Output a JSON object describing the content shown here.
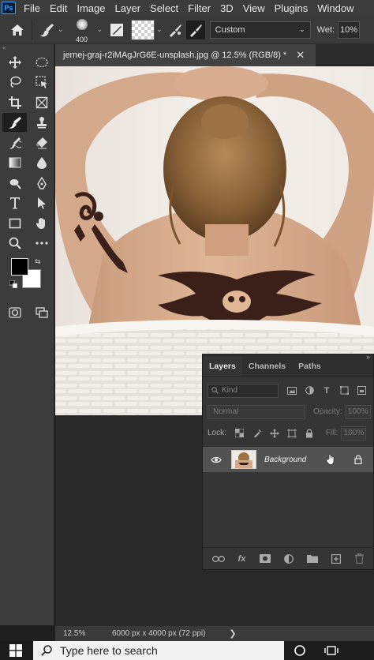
{
  "app": {
    "logo_text": "Ps"
  },
  "menu": [
    "File",
    "Edit",
    "Image",
    "Layer",
    "Select",
    "Filter",
    "3D",
    "View",
    "Plugins",
    "Window"
  ],
  "options_bar": {
    "brush_size": "400",
    "preset_value": "Custom",
    "wet_label": "Wet:",
    "wet_value": "10%"
  },
  "document": {
    "tab_title": "jernej-graj-r2iMAgJrG6E-unsplash.jpg @ 12.5% (RGB/8) *",
    "close_glyph": "✕"
  },
  "colors": {
    "foreground": "#000000",
    "background": "#ffffff",
    "accent": "#31a8ff"
  },
  "layers_panel": {
    "tabs": [
      "Layers",
      "Channels",
      "Paths"
    ],
    "active_tab": "Layers",
    "kind_placeholder": "Kind",
    "blend_mode": "Normal",
    "opacity_label": "Opacity:",
    "opacity_value": "100%",
    "lock_label": "Lock:",
    "fill_label": "Fill:",
    "fill_value": "100%",
    "layers": [
      {
        "name": "Background",
        "visible": true,
        "locked": true
      }
    ]
  },
  "status_bar": {
    "zoom": "12.5%",
    "doc_info": "6000 px x 4000 px (72 ppi)",
    "arrow": "❯"
  },
  "taskbar": {
    "search_placeholder": "Type here to search"
  }
}
